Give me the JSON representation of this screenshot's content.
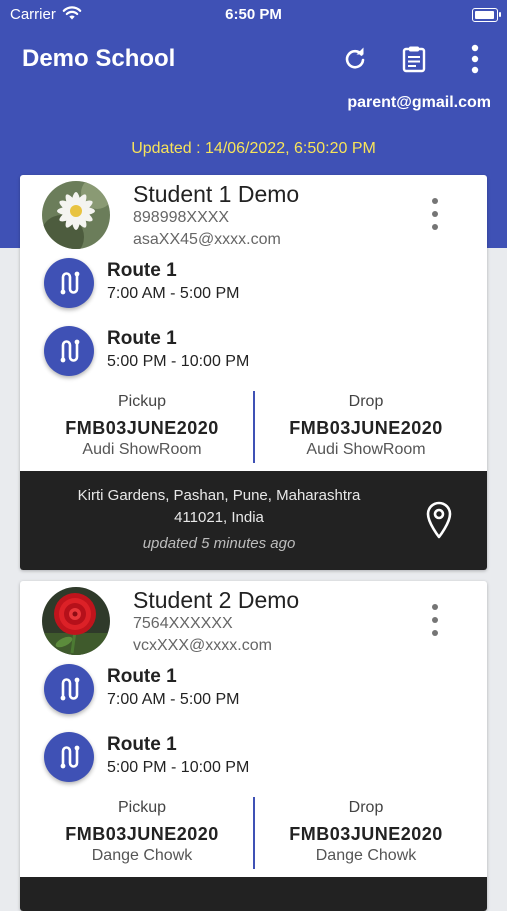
{
  "status_bar": {
    "carrier": "Carrier",
    "time": "6:50 PM",
    "battery_level": 0.95
  },
  "header": {
    "title": "Demo School",
    "account": "parent@gmail.com",
    "updated": "Updated : 14/06/2022,  6:50:20 PM",
    "icons": [
      "refresh-icon",
      "clipboard-icon",
      "more-vert-icon"
    ]
  },
  "students": [
    {
      "name": "Student 1 Demo",
      "phone": "898998XXXX",
      "email": "asaXX45@xxxx.com",
      "avatar": "white-daisy-photo",
      "routes": [
        {
          "name": "Route 1",
          "time": "7:00 AM - 5:00 PM"
        },
        {
          "name": "Route 1",
          "time": "5:00 PM - 10:00 PM"
        }
      ],
      "pickup": {
        "label": "Pickup",
        "code": "FMB03JUNE2020",
        "place": "Audi ShowRoom"
      },
      "drop": {
        "label": "Drop",
        "code": "FMB03JUNE2020",
        "place": "Audi ShowRoom"
      },
      "location": {
        "address_line1": "Kirti Gardens, Pashan, Pune, Maharashtra",
        "address_line2": "411021, India",
        "updated": "updated 5 minutes ago"
      }
    },
    {
      "name": "Student 2 Demo",
      "phone": "7564XXXXXX",
      "email": "vcxXXX@xxxx.com",
      "avatar": "red-dahlia-photo",
      "routes": [
        {
          "name": "Route 1",
          "time": "7:00 AM - 5:00 PM"
        },
        {
          "name": "Route 1",
          "time": "5:00 PM - 10:00 PM"
        }
      ],
      "pickup": {
        "label": "Pickup",
        "code": "FMB03JUNE2020",
        "place": "Dange Chowk"
      },
      "drop": {
        "label": "Drop",
        "code": "FMB03JUNE2020",
        "place": "Dange Chowk"
      }
    }
  ],
  "colors": {
    "primary": "#3f51b5",
    "updated_text": "#f7e35a",
    "footer": "#222222",
    "background": "#e9ebee"
  }
}
